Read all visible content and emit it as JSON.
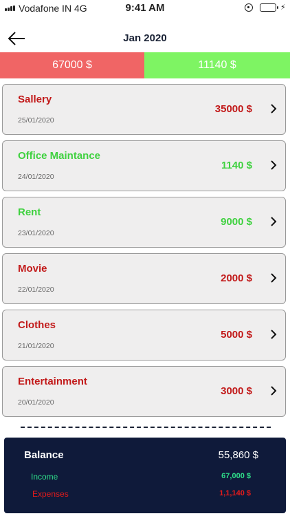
{
  "status_bar": {
    "carrier": "Vodafone IN 4G",
    "time": "9:41 AM",
    "icons": [
      "signal-icon",
      "orientation-lock-icon",
      "battery-icon",
      "charging-bolt-icon"
    ]
  },
  "header": {
    "title": "Jan 2020",
    "back_icon": "arrow-left-icon"
  },
  "totals": {
    "expense": "67000 $",
    "income": "11140 $",
    "colors": {
      "expense_bg": "#f06565",
      "income_bg": "#7ef463"
    }
  },
  "transactions": [
    {
      "name": "Sallery",
      "date": "25/01/2020",
      "amount": "35000 $",
      "type": "expense"
    },
    {
      "name": "Office Maintance",
      "date": "24/01/2020",
      "amount": "1140 $",
      "type": "income"
    },
    {
      "name": "Rent",
      "date": "23/01/2020",
      "amount": "9000 $",
      "type": "income"
    },
    {
      "name": "Movie",
      "date": "22/01/2020",
      "amount": "2000 $",
      "type": "expense"
    },
    {
      "name": "Clothes",
      "date": "21/01/2020",
      "amount": "5000 $",
      "type": "expense"
    },
    {
      "name": "Entertainment",
      "date": "20/01/2020",
      "amount": "3000 $",
      "type": "expense"
    }
  ],
  "balance": {
    "label": "Balance",
    "value": "55,860 $",
    "income_label": "Income",
    "income_value": "67,000 $",
    "expenses_label": "Expenses",
    "expenses_value": "1,1,140 $",
    "colors": {
      "panel_bg": "#0f1a3a",
      "income": "#2fe08a",
      "expenses": "#e31b1b"
    }
  }
}
